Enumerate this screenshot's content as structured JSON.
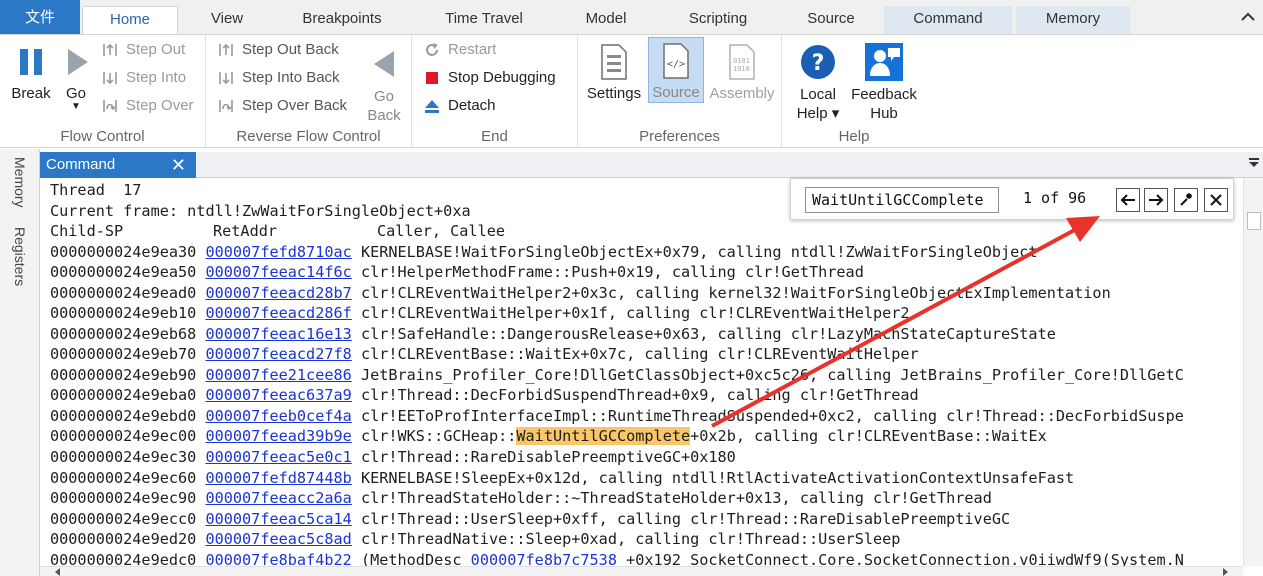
{
  "ribbon": {
    "tabs": [
      {
        "id": "file",
        "label": "文件"
      },
      {
        "id": "home",
        "label": "Home"
      },
      {
        "id": "view",
        "label": "View"
      },
      {
        "id": "breakpoints",
        "label": "Breakpoints"
      },
      {
        "id": "timetravel",
        "label": "Time Travel"
      },
      {
        "id": "model",
        "label": "Model"
      },
      {
        "id": "scripting",
        "label": "Scripting"
      },
      {
        "id": "source",
        "label": "Source"
      },
      {
        "id": "command",
        "label": "Command"
      },
      {
        "id": "memory",
        "label": "Memory"
      }
    ],
    "groups": {
      "flow_control": {
        "label": "Flow Control",
        "break": "Break",
        "go": "Go",
        "step_out": "Step Out",
        "step_into": "Step Into",
        "step_over": "Step Over"
      },
      "reverse_flow_control": {
        "label": "Reverse Flow Control",
        "step_out_back": "Step Out Back",
        "step_into_back": "Step Into Back",
        "step_over_back": "Step Over Back",
        "go_back_1": "Go",
        "go_back_2": "Back"
      },
      "end": {
        "label": "End",
        "restart": "Restart",
        "stop_debugging": "Stop Debugging",
        "detach": "Detach"
      },
      "preferences": {
        "label": "Preferences",
        "settings": "Settings",
        "source": "Source",
        "assembly": "Assembly"
      },
      "help": {
        "label": "Help",
        "local_help_1": "Local",
        "local_help_2": "Help ▾",
        "feedback_hub_1": "Feedback",
        "feedback_hub_2": "Hub"
      }
    }
  },
  "side_tabs": {
    "memory": "Memory",
    "registers": "Registers"
  },
  "command_window": {
    "tab_label": "Command",
    "close_glyph": "✕",
    "header_lines": [
      "Thread  17",
      "Current frame: ntdll!ZwWaitForSingleObject+0xa"
    ],
    "columns": {
      "child_sp": "Child-SP",
      "ret_addr": "RetAddr",
      "caller": "Caller, Callee"
    },
    "rows": [
      {
        "sp": "0000000024e9ea30",
        "ret": "000007fefd8710ac",
        "pre": "KERNELBASE!WaitForSingleObjectEx+0x79, calling ntdll!ZwWaitForSingleObject"
      },
      {
        "sp": "0000000024e9ea50",
        "ret": "000007feeac14f6c",
        "pre": "clr!HelperMethodFrame::Push+0x19, calling clr!GetThread"
      },
      {
        "sp": "0000000024e9ead0",
        "ret": "000007feeacd28b7",
        "pre": "clr!CLREventWaitHelper2+0x3c, calling kernel32!WaitForSingleObjectExImplementation"
      },
      {
        "sp": "0000000024e9eb10",
        "ret": "000007feeacd286f",
        "pre": "clr!CLREventWaitHelper+0x1f, calling clr!CLREventWaitHelper2"
      },
      {
        "sp": "0000000024e9eb68",
        "ret": "000007feeac16e13",
        "pre": "clr!SafeHandle::DangerousRelease+0x63, calling clr!LazyMachStateCaptureState"
      },
      {
        "sp": "0000000024e9eb70",
        "ret": "000007feeacd27f8",
        "pre": "clr!CLREventBase::WaitEx+0x7c, calling clr!CLREventWaitHelper"
      },
      {
        "sp": "0000000024e9eb90",
        "ret": "000007fee21cee86",
        "pre": "JetBrains_Profiler_Core!DllGetClassObject+0xc5c26, calling JetBrains_Profiler_Core!DllGetC"
      },
      {
        "sp": "0000000024e9eba0",
        "ret": "000007feeac637a9",
        "pre": "clr!Thread::DecForbidSuspendThread+0x9, calling clr!GetThread"
      },
      {
        "sp": "0000000024e9ebd0",
        "ret": "000007feeb0cef4a",
        "pre": "clr!EEToProfInterfaceImpl::RuntimeThreadSuspended+0xc2, calling clr!Thread::DecForbidSuspe"
      },
      {
        "sp": "0000000024e9ec00",
        "ret": "000007feead39b9e",
        "pre": "clr!WKS::GCHeap::",
        "match": "WaitUntilGCComplete",
        "post": "+0x2b, calling clr!CLREventBase::WaitEx"
      },
      {
        "sp": "0000000024e9ec30",
        "ret": "000007feeac5e0c1",
        "pre": "clr!Thread::RareDisablePreemptiveGC+0x180"
      },
      {
        "sp": "0000000024e9ec60",
        "ret": "000007fefd87448b",
        "pre": "KERNELBASE!SleepEx+0x12d, calling ntdll!RtlActivateActivationContextUnsafeFast"
      },
      {
        "sp": "0000000024e9ec90",
        "ret": "000007feeacc2a6a",
        "pre": "clr!ThreadStateHolder::~ThreadStateHolder+0x13, calling clr!GetThread"
      },
      {
        "sp": "0000000024e9ecc0",
        "ret": "000007feeac5ca14",
        "pre": "clr!Thread::UserSleep+0xff, calling clr!Thread::RareDisablePreemptiveGC"
      },
      {
        "sp": "0000000024e9ed20",
        "ret": "000007feeac5c8ad",
        "pre": "clr!ThreadNative::Sleep+0xad, calling clr!Thread::UserSleep"
      },
      {
        "sp": "0000000024e9edc0",
        "ret": "000007fe8baf4b22",
        "pre": "(MethodDesc ",
        "link2": "000007fe8b7c7538",
        "post": " +0x192 SocketConnect.Core.SocketConnection.v0iiwdWf9(System.N"
      }
    ]
  },
  "find": {
    "query": "WaitUntilGCComplete",
    "count": "1 of 96"
  },
  "colors": {
    "accent": "#2a78c6",
    "link": "#1a33d6",
    "highlight": "#f9c66a",
    "annotation_arrow": "#e8322a"
  }
}
